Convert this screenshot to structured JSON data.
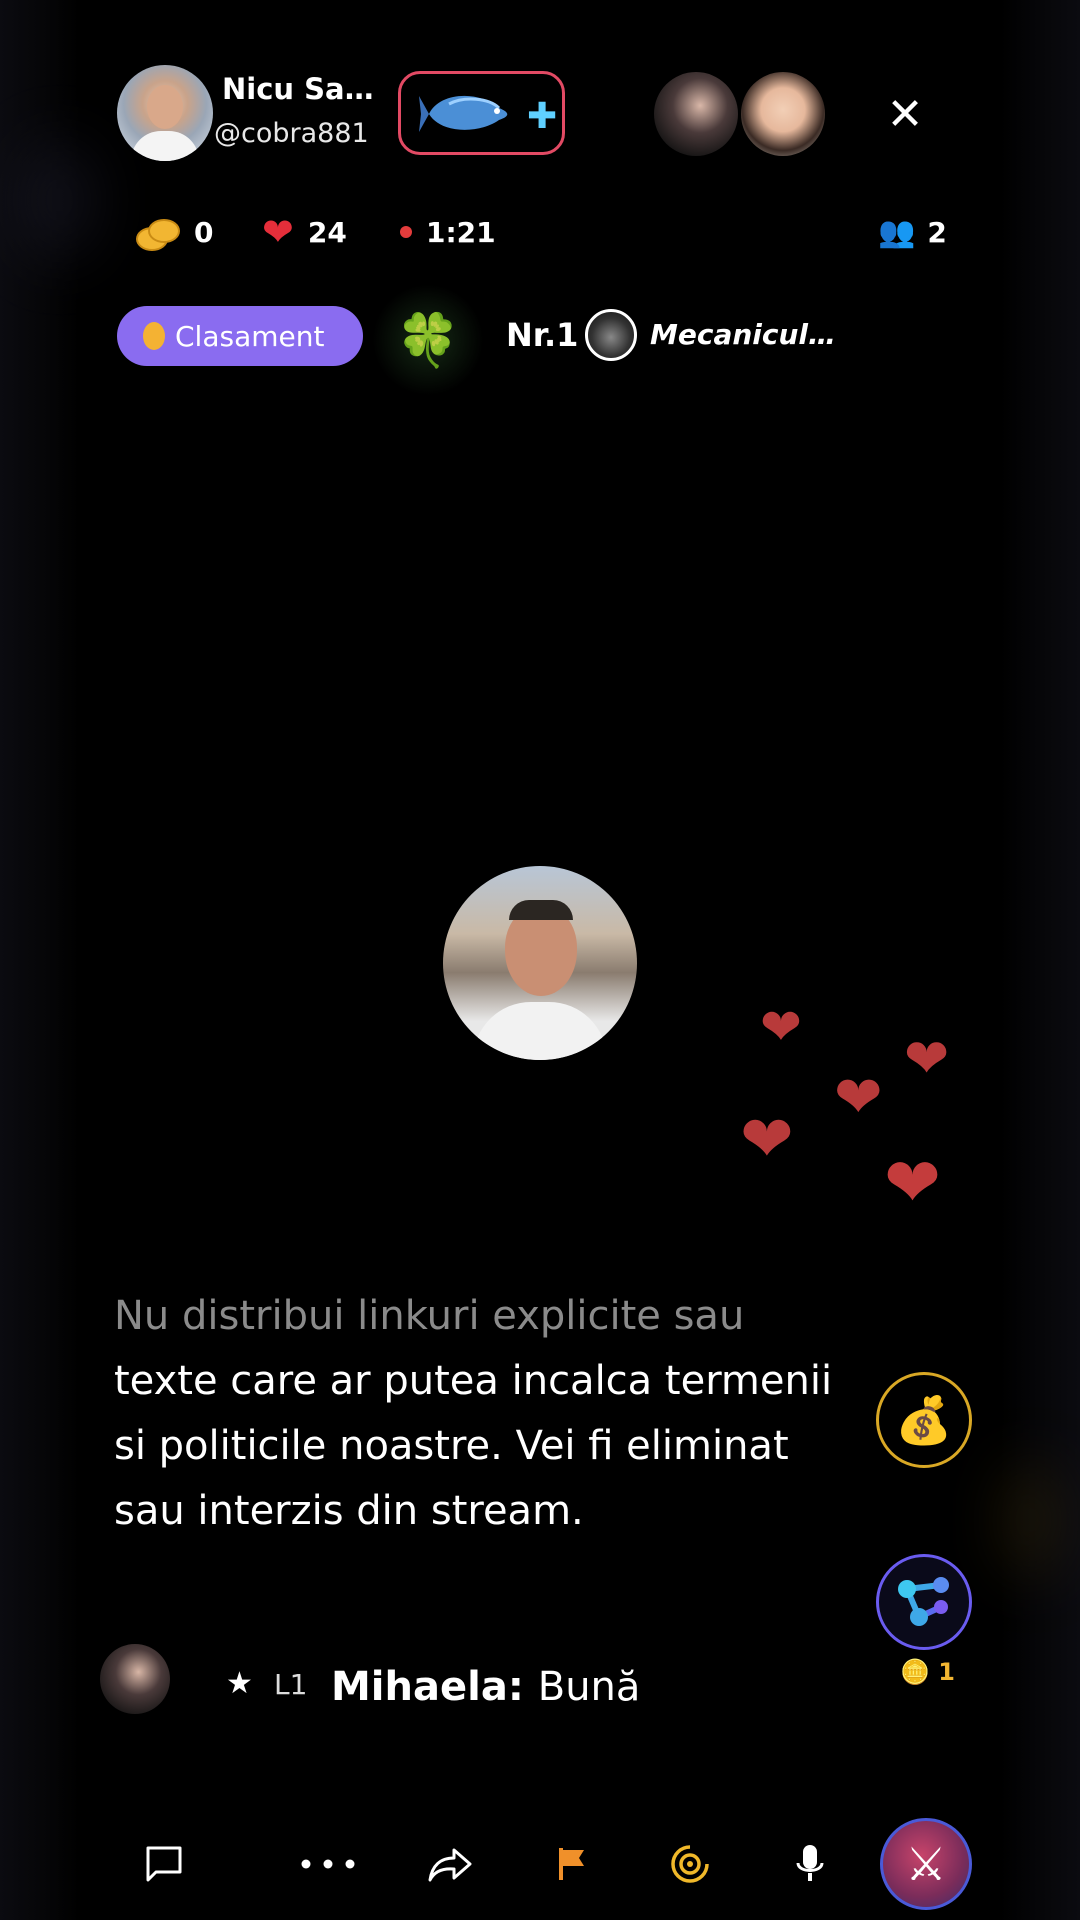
{
  "header": {
    "host_name": "Nicu Sa…",
    "host_handle": "@cobra881",
    "close_label": "✕"
  },
  "stats": {
    "coins": "0",
    "likes": "24",
    "duration": "1:21",
    "viewers": "2"
  },
  "ranking": {
    "button_label": "Clasament",
    "position": "Nr.1",
    "top_user": "Mecanicul…"
  },
  "notice": {
    "text_dim": "Nu distribui linkuri explicite sau",
    "text_main": "texte care ar putea incalca termenii si politicile noastre. Vei fi eliminat sau interzis din stream."
  },
  "chat": {
    "level": "L1",
    "username": "Mihaela",
    "message": "Bună"
  },
  "side": {
    "network_coins": "1"
  },
  "colors": {
    "accent_purple": "#8a6cf0",
    "gift_border": "#e24a64",
    "coin_gold": "#f2b632",
    "heart_red": "#e52e3a"
  },
  "icons": {
    "bottom_bar": [
      "chat-icon",
      "more-icon",
      "share-icon",
      "flag-icon",
      "radar-icon",
      "microphone-icon",
      "battle-icon"
    ]
  }
}
